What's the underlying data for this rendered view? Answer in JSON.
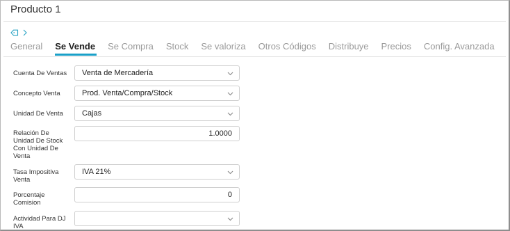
{
  "window": {
    "title": "Producto 1"
  },
  "tabs": [
    {
      "label": "General",
      "active": false
    },
    {
      "label": "Se Vende",
      "active": true
    },
    {
      "label": "Se Compra",
      "active": false
    },
    {
      "label": "Stock",
      "active": false
    },
    {
      "label": "Se valoriza",
      "active": false
    },
    {
      "label": "Otros Códigos",
      "active": false
    },
    {
      "label": "Distribuye",
      "active": false
    },
    {
      "label": "Precios",
      "active": false
    },
    {
      "label": "Config. Avanzada",
      "active": false
    }
  ],
  "form": {
    "cuenta_venta": {
      "label": "Cuenta De Ventas",
      "value": "Venta de Mercadería",
      "control": "select"
    },
    "concepto_venta": {
      "label": "Concepto Venta",
      "value": "Prod. Venta/Compra/Stock",
      "control": "select"
    },
    "unidad_venta": {
      "label": "Unidad De Venta",
      "value": "Cajas",
      "control": "select"
    },
    "relacion_unidad": {
      "label": "Relación De Unidad De Stock Con Unidad De Venta",
      "value": "1.0000",
      "control": "number"
    },
    "tasa_impositiva": {
      "label": "Tasa Impositiva Venta",
      "value": "IVA 21%",
      "control": "select"
    },
    "porcentaje_comision": {
      "label": "Porcentaje Comision",
      "value": "0",
      "control": "number"
    },
    "actividad_dj_iva": {
      "label": "Actividad Para DJ IVA",
      "value": "",
      "control": "select"
    }
  },
  "colors": {
    "accent": "#1aa0c8",
    "inactive_tab": "#9a9a9a",
    "tag_icon": "#2aa3c4"
  },
  "icons": {
    "tag": "tag-icon",
    "breadcrumb_arrow": "chevron-right-icon",
    "dropdown": "chevron-down-icon"
  }
}
